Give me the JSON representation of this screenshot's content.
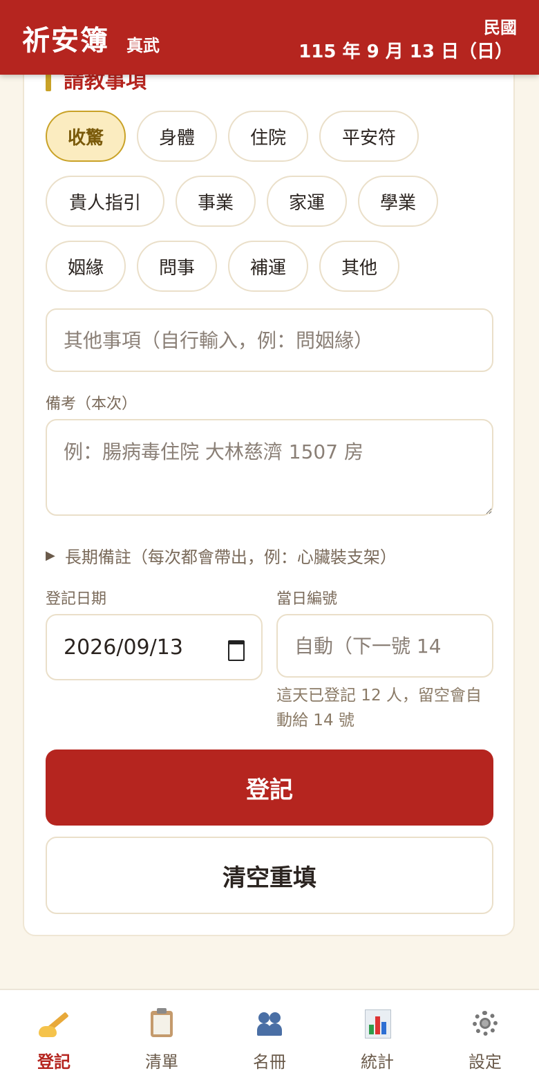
{
  "header": {
    "app_title": "祈安簿",
    "temple": "真武",
    "date_era": "民國",
    "date_full": "115 年 9 月 13 日（日）"
  },
  "section": {
    "title": "請教事項"
  },
  "chips": [
    {
      "label": "收驚",
      "active": true
    },
    {
      "label": "身體",
      "active": false
    },
    {
      "label": "住院",
      "active": false
    },
    {
      "label": "平安符",
      "active": false
    },
    {
      "label": "貴人指引",
      "active": false
    },
    {
      "label": "事業",
      "active": false
    },
    {
      "label": "家運",
      "active": false
    },
    {
      "label": "學業",
      "active": false
    },
    {
      "label": "姻緣",
      "active": false
    },
    {
      "label": "問事",
      "active": false
    },
    {
      "label": "補運",
      "active": false
    },
    {
      "label": "其他",
      "active": false
    }
  ],
  "other_input": {
    "placeholder": "其他事項（自行輸入，例：問姻緣）",
    "value": ""
  },
  "note": {
    "label": "備考（本次）",
    "placeholder": "例：腸病毒住院 大林慈濟 1507 房",
    "value": ""
  },
  "long_note": {
    "label": "長期備註（每次都會帶出，例：心臟裝支架）",
    "expanded": false
  },
  "date_field": {
    "label": "登記日期",
    "value": "2026/09/13",
    "icon": "calendar-icon"
  },
  "number_field": {
    "label": "當日編號",
    "placeholder": "自動（下一號 14",
    "value": ""
  },
  "hint": "這天已登記 12 人，留空會自動給 14 號",
  "actions": {
    "submit_label": "登記",
    "clear_label": "清空重填"
  },
  "colors": {
    "primary": "#b5251f",
    "accent": "#c9a227",
    "active_chip_bg": "#fbecc0"
  },
  "nav": [
    {
      "label": "登記",
      "icon": "writing-hand-icon",
      "active": true
    },
    {
      "label": "清單",
      "icon": "clipboard-icon",
      "active": false
    },
    {
      "label": "名冊",
      "icon": "people-icon",
      "active": false
    },
    {
      "label": "統計",
      "icon": "bar-chart-icon",
      "active": false
    },
    {
      "label": "設定",
      "icon": "gear-icon",
      "active": false
    }
  ]
}
